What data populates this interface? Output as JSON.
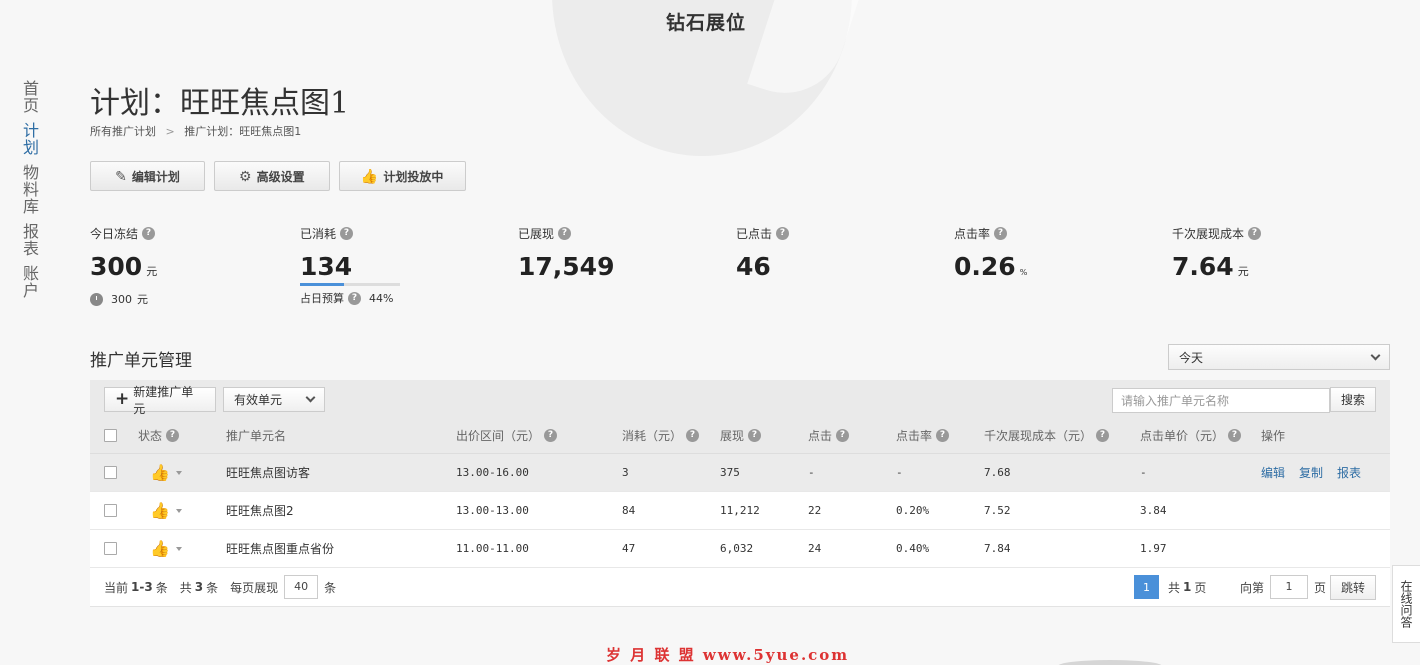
{
  "brand": {
    "name": "钻石展位"
  },
  "nav": {
    "items": [
      "首页",
      "计划",
      "物料库",
      "报表",
      "账户"
    ],
    "active_index": 1
  },
  "page": {
    "title": "计划：旺旺焦点图1"
  },
  "breadcrumb": {
    "root": "所有推广计划",
    "current": "推广计划：旺旺焦点图1"
  },
  "actions": {
    "edit": {
      "label": "编辑计划",
      "icon": "pencil-icon"
    },
    "advanced": {
      "label": "高级设置",
      "icon": "gear-icon"
    },
    "status": {
      "label": "计划投放中",
      "icon": "thumb-icon"
    }
  },
  "stats": {
    "frozen": {
      "label": "今日冻结",
      "value": "300",
      "unit": "元",
      "sub_value": "300",
      "sub_unit": "元"
    },
    "spent": {
      "label": "已消耗",
      "value": "134",
      "budget_label": "占日预算",
      "budget_pct": "44%",
      "budget_fraction": 0.44
    },
    "impressions": {
      "label": "已展现",
      "value": "17,549"
    },
    "clicks": {
      "label": "已点击",
      "value": "46"
    },
    "ctr": {
      "label": "点击率",
      "value": "0.26",
      "unit": "%"
    },
    "cpm": {
      "label": "千次展现成本",
      "value": "7.64",
      "unit": "元"
    }
  },
  "section": {
    "title": "推广单元管理",
    "date_filter": "今天"
  },
  "toolbar": {
    "new_unit": "新建推广单元",
    "status_filter": "有效单元",
    "search_placeholder": "请输入推广单元名称",
    "search_button": "搜索"
  },
  "table": {
    "columns": [
      "状态",
      "推广单元名",
      "出价区间（元）",
      "消耗（元）",
      "展现",
      "点击",
      "点击率",
      "千次展现成本（元）",
      "点击单价（元）",
      "操作"
    ],
    "rows": [
      {
        "name": "旺旺焦点图访客",
        "bid": "13.00-16.00",
        "cost": "3",
        "impr": "375",
        "clicks": "-",
        "ctr": "-",
        "cpm": "7.68",
        "cpc": "-",
        "ops": [
          "编辑",
          "复制",
          "报表"
        ]
      },
      {
        "name": "旺旺焦点图2",
        "bid": "13.00-13.00",
        "cost": "84",
        "impr": "11,212",
        "clicks": "22",
        "ctr": "0.20%",
        "cpm": "7.52",
        "cpc": "3.84",
        "ops": []
      },
      {
        "name": "旺旺焦点图重点省份",
        "bid": "11.00-11.00",
        "cost": "47",
        "impr": "6,032",
        "clicks": "24",
        "ctr": "0.40%",
        "cpm": "7.84",
        "cpc": "1.97",
        "ops": []
      }
    ]
  },
  "pager": {
    "current_prefix": "当前",
    "current_range": "1-3",
    "current_suffix": "条",
    "total_prefix": "共",
    "total_count": "3",
    "total_suffix": "条",
    "per_page_label": "每页展现",
    "per_page": "40",
    "per_page_suffix": "条",
    "current_page": "1",
    "pages_prefix": "共",
    "pages_count": "1",
    "pages_suffix": "页",
    "goto_label": "向第",
    "goto_value": "1",
    "goto_suffix": "页",
    "jump_button": "跳转"
  },
  "online_help": "在线问答",
  "watermark": "岁 月 联 盟  www.5yue.com"
}
